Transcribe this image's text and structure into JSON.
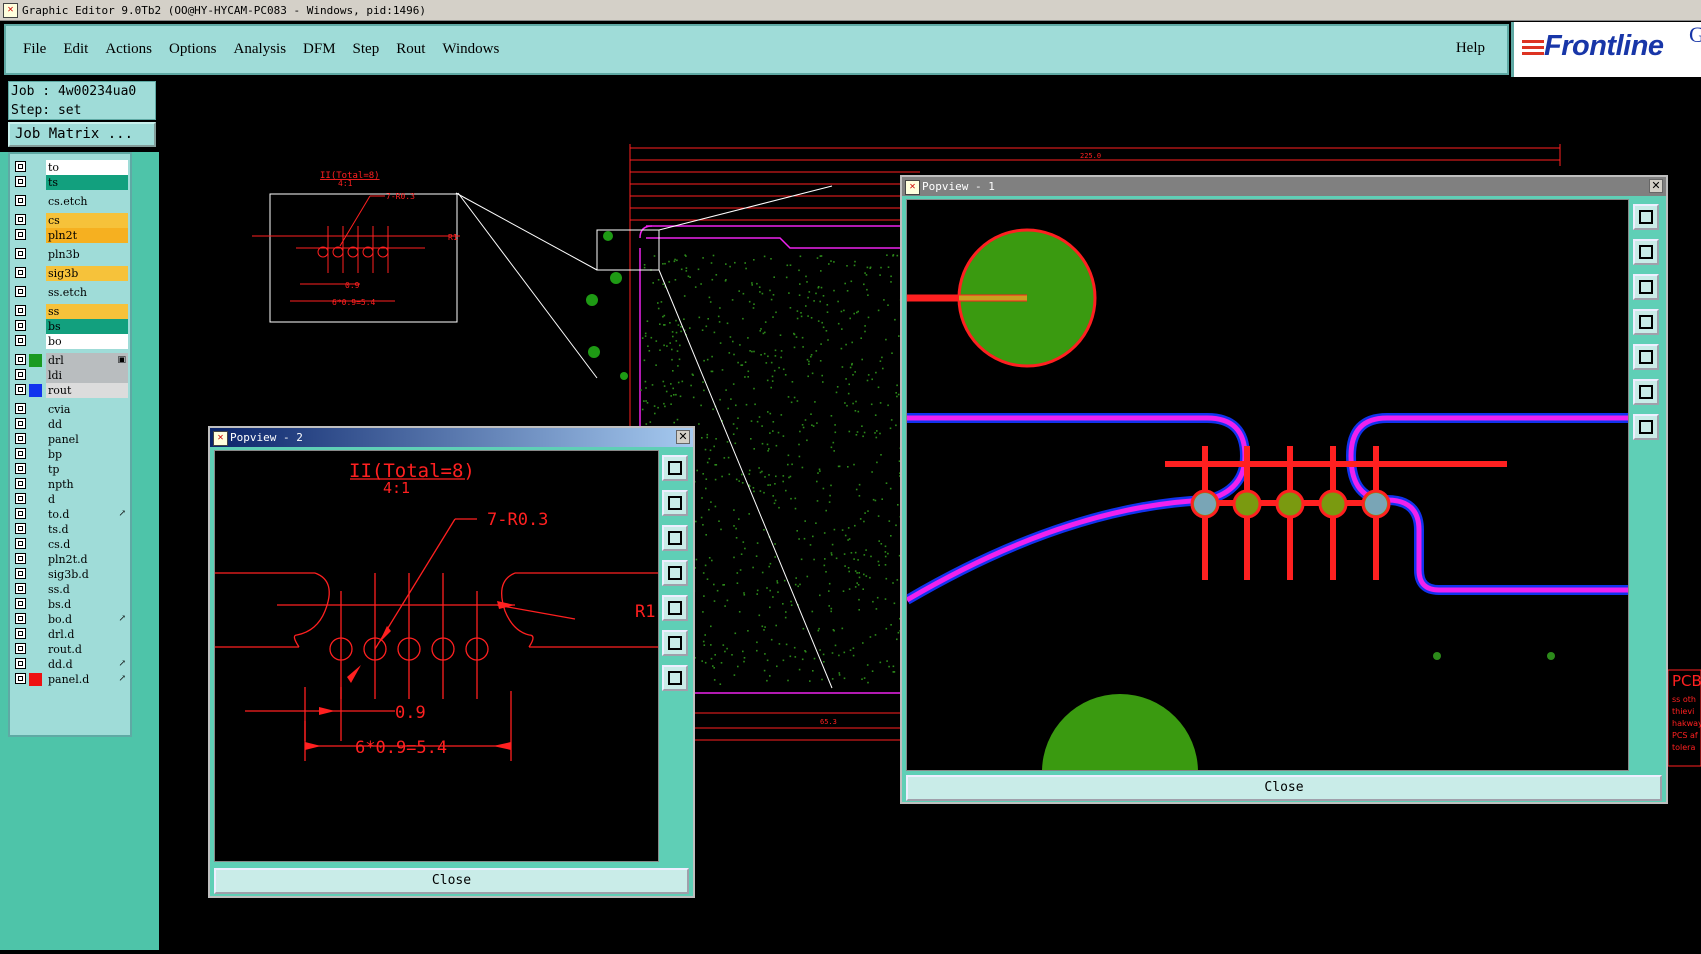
{
  "window": {
    "title": "Graphic Editor 9.0Tb2 (OO@HY-HYCAM-PC083 - Windows, pid:1496)"
  },
  "menu": {
    "items": [
      "File",
      "Edit",
      "Actions",
      "Options",
      "Analysis",
      "DFM",
      "Step",
      "Rout",
      "Windows"
    ],
    "help": "Help"
  },
  "logo": {
    "text": "Frontline",
    "suffix": "G"
  },
  "job": {
    "job_line": "Job : 4w00234ua0",
    "step_line": "Step: set",
    "matrix_button": "Job Matrix ..."
  },
  "layers": [
    {
      "name": "to",
      "color": "#ffffff"
    },
    {
      "name": "ts",
      "color": "#12a07e"
    },
    {
      "name": "cs.etch",
      "color": "#9fdcd8"
    },
    {
      "name": "cs",
      "color": "#f6c23a"
    },
    {
      "name": "pln2t",
      "color": "#f6b020"
    },
    {
      "name": "pln3b",
      "color": "#9fdcd8"
    },
    {
      "name": "sig3b",
      "color": "#f6c23a"
    },
    {
      "name": "ss.etch",
      "color": "#9fdcd8"
    },
    {
      "name": "ss",
      "color": "#f6c23a"
    },
    {
      "name": "bs",
      "color": "#12a07e"
    },
    {
      "name": "bo",
      "color": "#ffffff"
    },
    {
      "name": "drl",
      "color": "#b9bdbf",
      "swatch": "#1a9a22",
      "mark": "▣"
    },
    {
      "name": "ldi",
      "color": "#b9bdbf"
    },
    {
      "name": "rout",
      "color": "#dcdcdc",
      "swatch": "#1133ee"
    },
    {
      "name": "cvia",
      "color": "#9fdcd8"
    },
    {
      "name": "dd",
      "color": "#9fdcd8"
    },
    {
      "name": "panel",
      "color": "#9fdcd8"
    },
    {
      "name": "bp",
      "color": "#9fdcd8"
    },
    {
      "name": "tp",
      "color": "#9fdcd8"
    },
    {
      "name": "npth",
      "color": "#9fdcd8"
    },
    {
      "name": "d",
      "color": "#9fdcd8"
    },
    {
      "name": "to.d",
      "color": "#9fdcd8",
      "mark": "↗"
    },
    {
      "name": "ts.d",
      "color": "#9fdcd8"
    },
    {
      "name": "cs.d",
      "color": "#9fdcd8"
    },
    {
      "name": "pln2t.d",
      "color": "#9fdcd8"
    },
    {
      "name": "sig3b.d",
      "color": "#9fdcd8"
    },
    {
      "name": "ss.d",
      "color": "#9fdcd8"
    },
    {
      "name": "bs.d",
      "color": "#9fdcd8"
    },
    {
      "name": "bo.d",
      "color": "#9fdcd8",
      "mark": "↗"
    },
    {
      "name": "drl.d",
      "color": "#9fdcd8"
    },
    {
      "name": "rout.d",
      "color": "#9fdcd8"
    },
    {
      "name": "dd.d",
      "color": "#9fdcd8",
      "mark": "↗"
    },
    {
      "name": "panel.d",
      "color": "#9fdcd8",
      "swatch": "#ee1111",
      "mark": "↗"
    }
  ],
  "drawing": {
    "detail_title": "II(Total=8)",
    "detail_scale": "4:1",
    "radius_note": "7-R0.3",
    "r_label": "R1",
    "dim_pitch": "0.9",
    "dim_total": "6*0.9=5.4",
    "pcb_label": "PCB",
    "note_lines": [
      "ss oth",
      "thievi",
      "hakway",
      "PCS af",
      "tolera"
    ],
    "top_dim": "225.0",
    "bottom_dim": "65.3"
  },
  "popview2": {
    "title": "Popview - 2",
    "close": "Close"
  },
  "popview1": {
    "title": "Popview - 1",
    "close": "Close"
  },
  "colors": {
    "menu_bg": "#9fdcd8",
    "panel_accent": "#4ec4a9",
    "trace": "#ff2020",
    "route": "#ee22ee",
    "pad": "#3a9a10"
  }
}
